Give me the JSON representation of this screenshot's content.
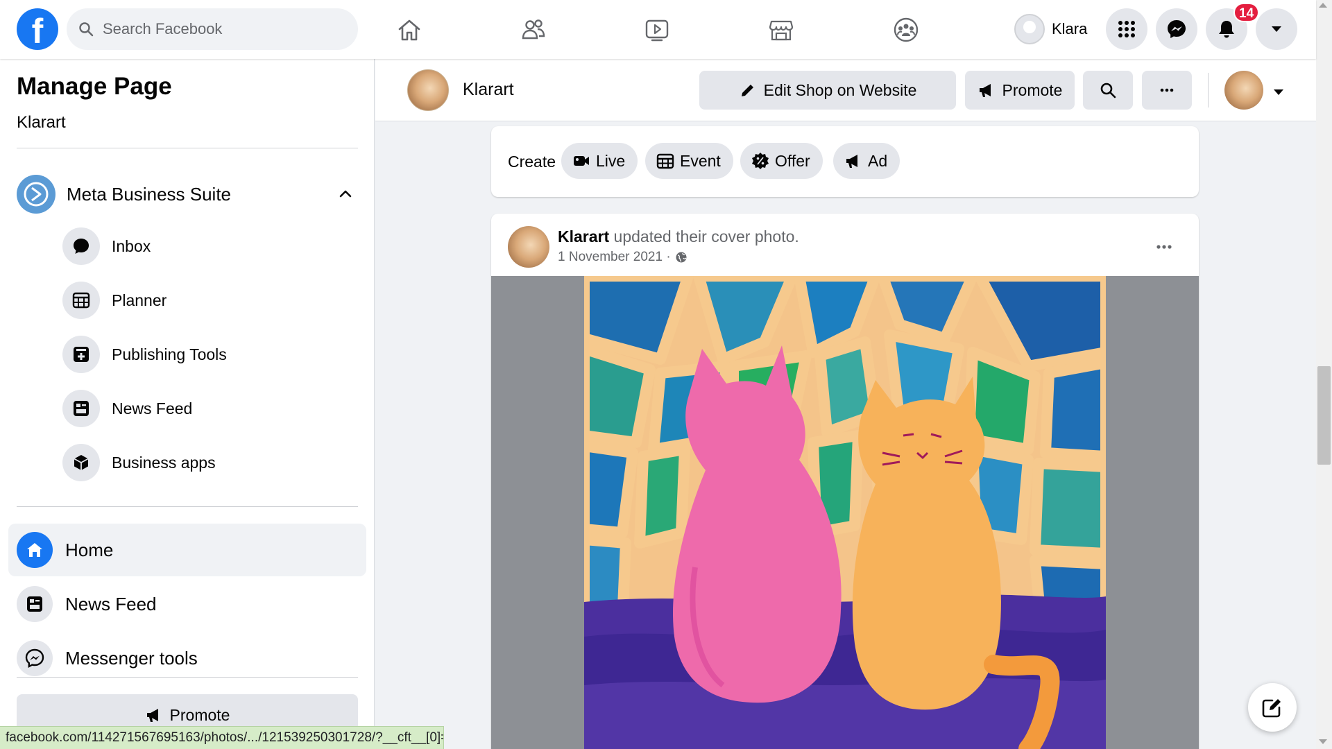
{
  "topbar": {
    "logo": "f",
    "search_placeholder": "Search Facebook",
    "nav_icons": [
      "home-icon",
      "friends-icon",
      "watch-icon",
      "marketplace-icon",
      "groups-icon"
    ],
    "user_name": "Klara",
    "notification_count": "14"
  },
  "sidebar": {
    "title": "Manage Page",
    "page_name": "Klarart",
    "business_suite": "Meta Business Suite",
    "sub_items": [
      {
        "label": "Inbox",
        "icon": "chat-bubble-icon"
      },
      {
        "label": "Planner",
        "icon": "calendar-grid-icon"
      },
      {
        "label": "Publishing Tools",
        "icon": "publishing-tools-icon"
      },
      {
        "label": "News Feed",
        "icon": "news-feed-icon"
      },
      {
        "label": "Business apps",
        "icon": "cube-icon"
      }
    ],
    "main_items": [
      {
        "label": "Home",
        "icon": "home-icon",
        "active": true
      },
      {
        "label": "News Feed",
        "icon": "news-feed-icon"
      },
      {
        "label": "Messenger tools",
        "icon": "messenger-icon"
      }
    ],
    "promote_label": "Promote"
  },
  "page_header": {
    "name": "Klarart",
    "edit_shop_label": "Edit Shop on Website",
    "promote_label": "Promote"
  },
  "create": {
    "label": "Create",
    "options": [
      "Live",
      "Event",
      "Offer",
      "Ad"
    ]
  },
  "post": {
    "author": "Klarart",
    "action": "updated their cover photo.",
    "date": "1 November 2021 ·",
    "image_alt": "Pastel drawing of a pink cat and an orange cat sitting side by side in front of a stained-glass window"
  },
  "status_bar_url": "facebook.com/114271567695163/photos/.../121539250301728/?__cft__[0]=A...",
  "colors": {
    "brand": "#1877f2",
    "badge": "#e41e3f",
    "background": "#f0f2f5"
  }
}
